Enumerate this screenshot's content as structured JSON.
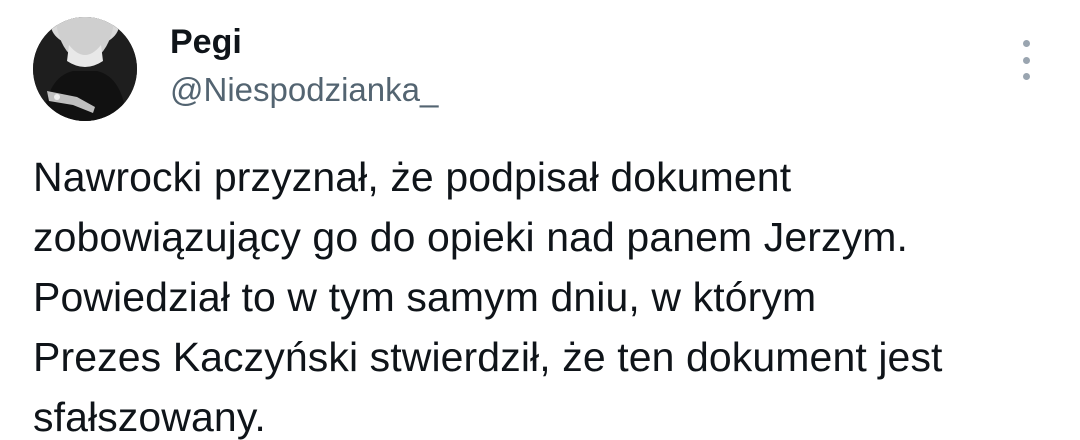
{
  "author": {
    "display_name": "Pegi",
    "handle": "@Niespodzianka_",
    "avatar_icon": "profile-photo"
  },
  "menu": {
    "icon": "more-vertical-icon"
  },
  "tweet": {
    "lines": [
      "Nawrocki przyznał, że podpisał dokument",
      "zobowiązujący go do opieki nad panem Jerzym.",
      "Powiedział to w tym samym dniu, w którym",
      "Prezes Kaczyński stwierdził, że ten dokument jest",
      "sfałszowany."
    ]
  },
  "colors": {
    "text": "#0f1419",
    "secondary": "#536471",
    "icon": "#9aa5b0"
  }
}
